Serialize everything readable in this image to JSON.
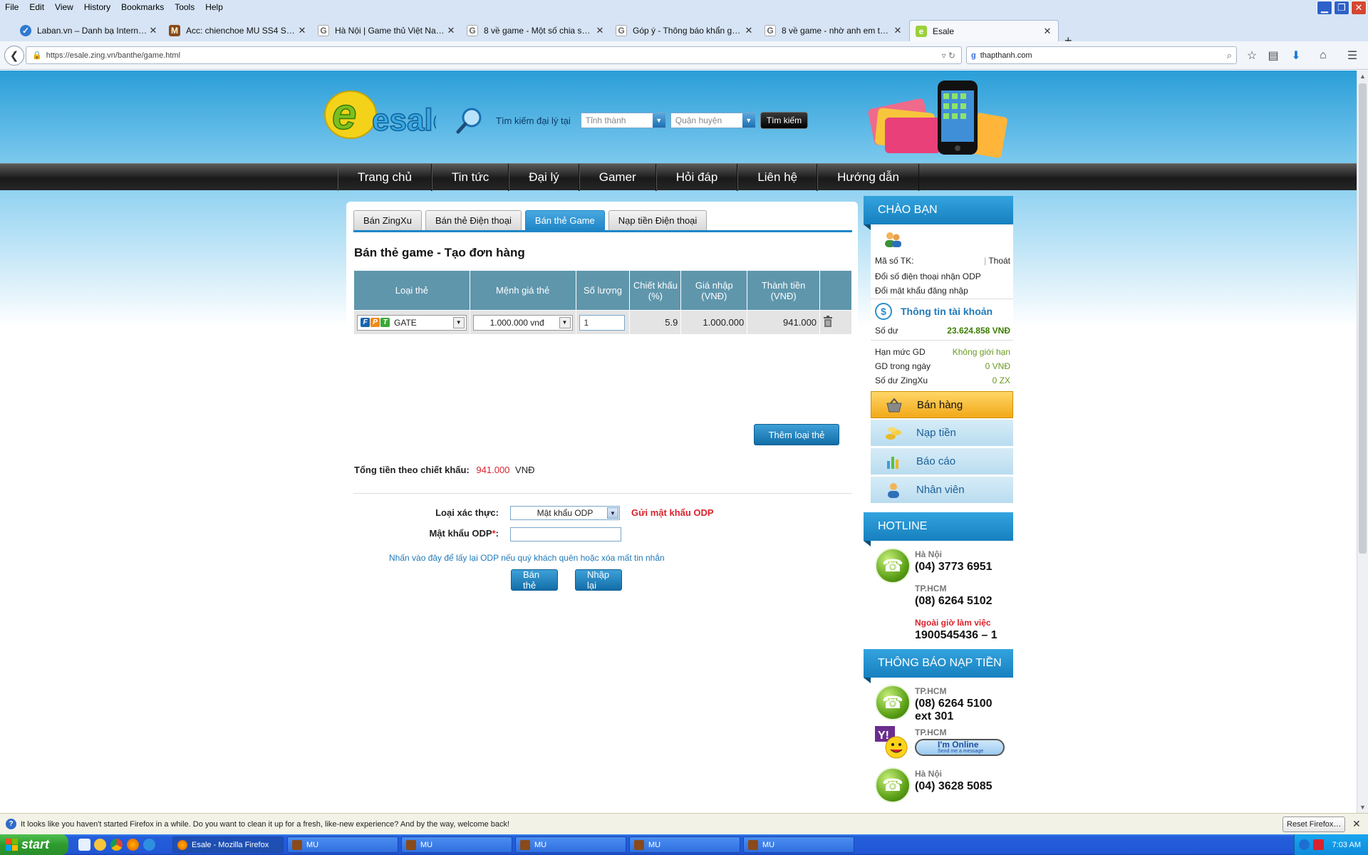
{
  "menubar": {
    "items": [
      "File",
      "Edit",
      "View",
      "History",
      "Bookmarks",
      "Tools",
      "Help"
    ]
  },
  "tabs": [
    {
      "label": "Laban.vn – Danh bạ Internet ...",
      "icon_text": "✓"
    },
    {
      "label": "Acc: chienchoe MU SS4 SS6 5...",
      "icon_text": "M"
    },
    {
      "label": "Hà Nội | Game thủ Việt Nam - ...",
      "icon_text": "G"
    },
    {
      "label": "8 về game - Một số chia sẻ về...",
      "icon_text": "G"
    },
    {
      "label": "Góp ý - Thông báo khẩn gửi đ...",
      "icon_text": "G"
    },
    {
      "label": "8 về game - nhờ anh em tư v...",
      "icon_text": "G"
    },
    {
      "label": "Esale",
      "icon_text": "e"
    }
  ],
  "navbar": {
    "url": "https://esale.zing.vn/banthe/game.html",
    "search_value": "thapthanh.com"
  },
  "header": {
    "search_label": "Tìm kiếm đại lý tại",
    "province_placeholder": "Tỉnh thành",
    "district_placeholder": "Quận huyện",
    "search_button": "Tìm kiếm",
    "logo_text": "esale"
  },
  "mainnav": [
    "Trang chủ",
    "Tin tức",
    "Đại lý",
    "Gamer",
    "Hỏi đáp",
    "Liên hệ",
    "Hướng dẫn"
  ],
  "content": {
    "tabs": [
      "Bán ZingXu",
      "Bán thẻ Điện thoại",
      "Bán thẻ Game",
      "Nạp tiền Điện thoại"
    ],
    "title": "Bán thẻ game - Tạo đơn hàng",
    "table": {
      "headers": [
        "Loại thẻ",
        "Mệnh giá thẻ",
        "Số lượng",
        "Chiết khấu (%)",
        "Giá nhập (VNĐ)",
        "Thành tiền (VNĐ)"
      ],
      "row": {
        "card_type": "GATE",
        "denomination": "1.000.000 vnđ",
        "quantity": "1",
        "discount": "5.9",
        "price": "1.000.000",
        "total": "941.000"
      }
    },
    "add_button": "Thêm loại thẻ",
    "total_label": "Tổng tiền theo chiết khấu:",
    "total_amount": "941.000",
    "total_currency": "VNĐ",
    "auth_label": "Loại xác thực:",
    "auth_value": "Mật khẩu ODP",
    "send_odp": "Gửi mật khẩu ODP",
    "odp_label": "Mật khẩu ODP",
    "odp_required": "*",
    "odp_colon": ":",
    "help_text": "Nhấn vào đây để lấy lại ODP nếu quý khách quên hoặc xóa mất tin nhắn",
    "sell_button": "Bán thẻ",
    "reset_button": "Nhập lại"
  },
  "sidebar": {
    "greeting_head": "CHÀO BẠN",
    "account_label": "Mã số TK:",
    "logout": "Thoát",
    "change_phone": "Đổi số điện thoại nhận ODP",
    "change_password": "Đổi mật khẩu đăng nhập",
    "account_info": "Thông tin tài khoản",
    "balance_label": "Số dư",
    "balance_value": "23.624.858 VNĐ",
    "limit_label": "Hạn mức GD",
    "limit_value": "Không giới hạn",
    "today_label": "GD trong ngày",
    "today_value": "0 VNĐ",
    "zingxu_label": "Số dư ZingXu",
    "zingxu_value": "0 ZX",
    "menu": [
      "Bán hàng",
      "Nạp tiền",
      "Báo cáo",
      "Nhân viên"
    ],
    "hotline_head": "HOTLINE",
    "hotline": [
      {
        "city": "Hà Nội",
        "number": "(04) 3773 6951"
      },
      {
        "city": "TP.HCM",
        "number": "(08) 6264 5102"
      }
    ],
    "after_hours_label": "Ngoài giờ làm việc",
    "after_hours_number": "1900545436 – 1",
    "notice_head": "THÔNG BÁO NẠP TIỀN",
    "notice": [
      {
        "city": "TP.HCM",
        "number": "(08) 6264 5100",
        "ext": "ext 301"
      },
      {
        "city": "TP.HCM",
        "yahoo_label": "I'm Online",
        "yahoo_sub": "Send me a message"
      },
      {
        "city": "Hà Nội",
        "number": "(04) 3628 5085"
      }
    ]
  },
  "notification": {
    "text": "It looks like you haven't started Firefox in a while. Do you want to clean it up for a fresh, like-new experience? And by the way, welcome back!",
    "reset_button": "Reset Firefox…"
  },
  "taskbar": {
    "start": "start",
    "tasks": [
      "Esale - Mozilla Firefox",
      "MU",
      "MU",
      "MU",
      "MU",
      "MU"
    ],
    "clock": "7:03 AM"
  },
  "colors": {
    "accent_blue": "#1f86c7",
    "total_red": "#d9232e",
    "nav_dark": "#1a1a1a",
    "menu_active": "#f2a918"
  }
}
